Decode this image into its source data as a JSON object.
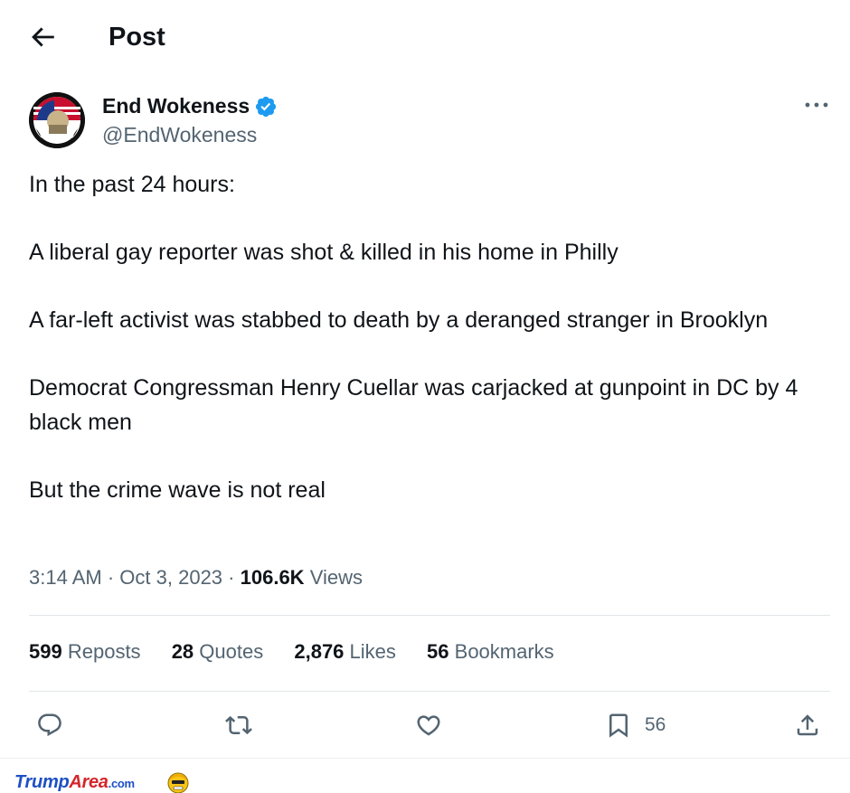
{
  "header": {
    "title": "Post",
    "back_icon": "arrow-left-icon"
  },
  "author": {
    "display_name": "End Wokeness",
    "handle": "@EndWokeness",
    "verified": true,
    "verified_color": "#1d9bf0"
  },
  "tweet": {
    "paragraphs": [
      "In the past 24 hours:",
      "A liberal gay reporter was shot & killed in his home in Philly",
      "A far-left activist was stabbed to death by a deranged stranger in Brooklyn",
      "Democrat Congressman Henry Cuellar was carjacked at gunpoint in DC by 4 black men",
      "But the crime wave is not real"
    ]
  },
  "meta": {
    "time": "3:14 AM",
    "sep1": "·",
    "date": "Oct 3, 2023",
    "sep2": "·",
    "views_count": "106.6K",
    "views_label": "Views"
  },
  "stats": [
    {
      "count": "599",
      "label": "Reposts"
    },
    {
      "count": "28",
      "label": "Quotes"
    },
    {
      "count": "2,876",
      "label": "Likes"
    },
    {
      "count": "56",
      "label": "Bookmarks"
    }
  ],
  "actions": {
    "reply_icon": "reply-icon",
    "repost_icon": "repost-icon",
    "like_icon": "heart-icon",
    "bookmark_icon": "bookmark-icon",
    "bookmark_count": "56",
    "share_icon": "share-icon"
  },
  "watermark": {
    "part1": "Trump",
    "part2": "Area",
    "part3": ".com"
  },
  "colors": {
    "text": "#0f1419",
    "secondary": "#536471",
    "divider": "#e1e6ea",
    "accent": "#1d9bf0"
  }
}
